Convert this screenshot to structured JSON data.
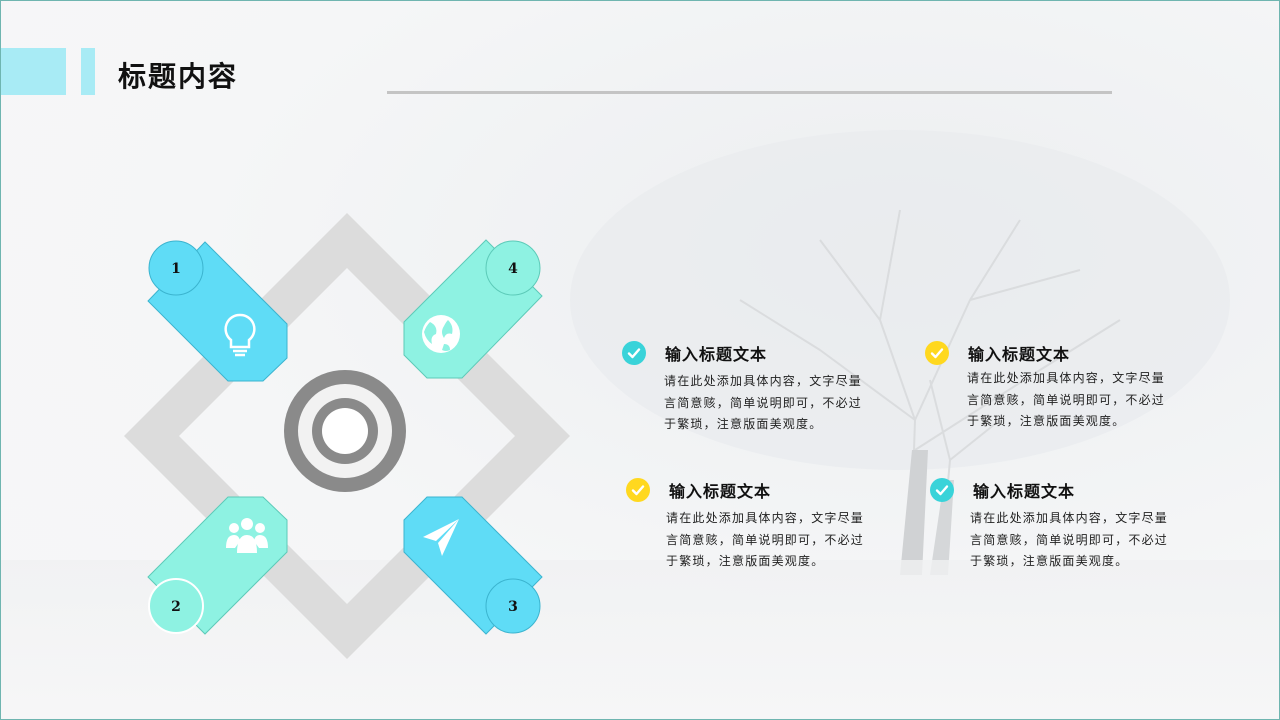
{
  "title": "标题内容",
  "colors": {
    "accent_bar": "#a8ebf5",
    "blue": "#5fdcf6",
    "teal": "#8ef2e2",
    "check_teal": "#39d3d9",
    "check_yellow": "#ffd81f",
    "gray_frame": "#dcdcdc",
    "target_gray": "#8a8a8a"
  },
  "diagram": {
    "segments": [
      {
        "number": "1",
        "icon": "lightbulb-icon",
        "color": "blue"
      },
      {
        "number": "2",
        "icon": "team-icon",
        "color": "teal"
      },
      {
        "number": "3",
        "icon": "paper-plane-icon",
        "color": "blue"
      },
      {
        "number": "4",
        "icon": "globe-icon",
        "color": "teal"
      }
    ],
    "center_icon": "target-icon"
  },
  "items": [
    {
      "title": "输入标题文本",
      "body": "请在此处添加具体内容，文字尽量言简意赅，简单说明即可，不必过于繁琐，注意版面美观度。",
      "check_color": "check_teal"
    },
    {
      "title": "输入标题文本",
      "body": "请在此处添加具体内容，文字尽量言简意赅，简单说明即可，不必过于繁琐，注意版面美观度。",
      "check_color": "check_yellow"
    },
    {
      "title": "输入标题文本",
      "body": "请在此处添加具体内容，文字尽量言简意赅，简单说明即可，不必过于繁琐，注意版面美观度。",
      "check_color": "check_yellow"
    },
    {
      "title": "输入标题文本",
      "body": "请在此处添加具体内容，文字尽量言简意赅，简单说明即可，不必过于繁琐，注意版面美观度。",
      "check_color": "check_teal"
    }
  ]
}
